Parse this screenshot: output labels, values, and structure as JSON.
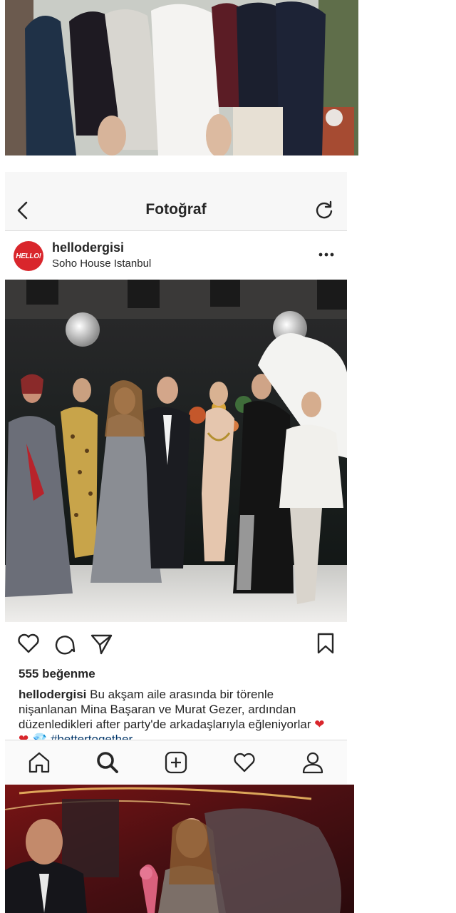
{
  "nav": {
    "title": "Fotoğraf"
  },
  "post": {
    "avatar_text": "HELLO!",
    "username": "hellodergisi",
    "location": "Soho House Istanbul",
    "likes": "555 beğenme",
    "caption_user": "hellodergisi",
    "caption_text": " Bu akşam aile arasında bir törenle nişanlanan Mina Başaran ve Murat Gezer, ardından düzenledikleri after party'de arkadaşlarıyla eğleniyorlar ",
    "caption_emoji": "❤ ❤ 💎",
    "caption_tags": " #bettertogether"
  },
  "icons": {
    "back": "back-chevron-icon",
    "refresh": "refresh-icon",
    "more": "more-horizontal-icon",
    "like": "heart-icon",
    "comment": "comment-icon",
    "share": "send-icon",
    "save": "bookmark-icon",
    "home": "home-icon",
    "search": "search-icon",
    "add": "add-post-icon",
    "activity": "heart-icon",
    "profile": "profile-icon"
  },
  "colors": {
    "text": "#262626",
    "avatar_bg": "#d9262c",
    "nav_bg": "#f7f7f7",
    "divider": "#dbdbdb",
    "hashtag": "#003569"
  }
}
